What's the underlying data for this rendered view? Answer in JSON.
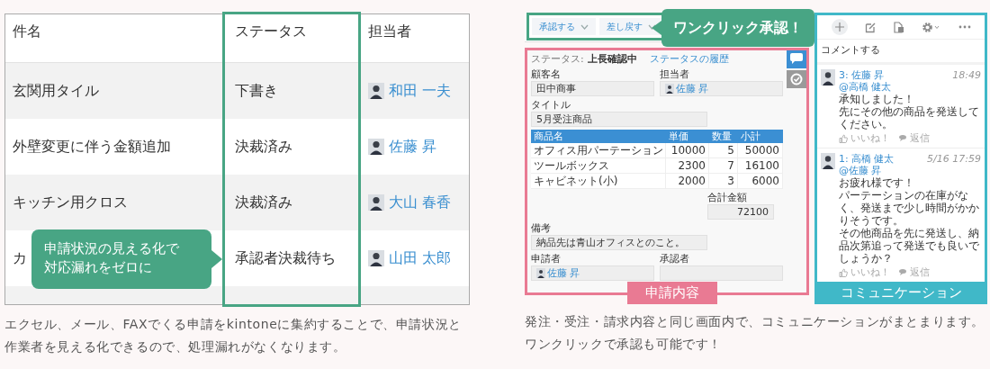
{
  "left": {
    "table": {
      "columns": [
        "件名",
        "ステータス",
        "担当者"
      ],
      "rows": [
        {
          "subject": "玄関用タイル",
          "status": "下書き",
          "assignee": "和田 一夫"
        },
        {
          "subject": "外壁変更に伴う金額追加",
          "status": "決裁済み",
          "assignee": "佐藤 昇"
        },
        {
          "subject": "キッチン用クロス",
          "status": "決裁済み",
          "assignee": "大山 春香"
        },
        {
          "subject": "カ",
          "status": "承認者決裁待ち",
          "assignee": "山田 太郎"
        }
      ]
    },
    "callout": [
      "申請状況の見える化で",
      "対応漏れをゼロに"
    ],
    "caption": "エクセル、メール、FAXでくる申請をkintoneに集約することで、申請状況と作業者を見える化できるので、処理漏れがなくなります。"
  },
  "right": {
    "actions": [
      "承認する",
      "差し戻す"
    ],
    "callout": "ワンクリック承認！",
    "record": {
      "status_label": "ステータス:",
      "status": "上長確認中",
      "history_link": "ステータスの履歴",
      "rows": [
        [
          {
            "kind": "text",
            "label": "顧客名",
            "value": "田中商事"
          },
          {
            "kind": "user",
            "label": "担当者",
            "value": "佐藤 昇"
          }
        ],
        [
          {
            "kind": "text",
            "label": "タイトル",
            "value": "5月受注商品"
          }
        ],
        [
          {
            "kind": "table",
            "columns": [
              "商品名",
              "単価",
              "数量",
              "小計"
            ],
            "rows": [
              [
                "オフィス用パーテーション",
                "10000",
                "5",
                "50000"
              ],
              [
                "ツールボックス",
                "2300",
                "7",
                "16100"
              ],
              [
                "キャビネット(小)",
                "2000",
                "3",
                "6000"
              ]
            ]
          }
        ],
        [
          {
            "kind": "number",
            "label": "合計金額",
            "value": "72100"
          }
        ],
        [
          {
            "kind": "text",
            "label": "備考",
            "value": "納品先は青山オフィスとのこと。"
          }
        ],
        [
          {
            "kind": "user",
            "label": "申請者",
            "value": "佐藤 昇"
          },
          {
            "kind": "text",
            "label": "承認者"
          }
        ]
      ],
      "side_tabs": [
        {
          "kind": "comments",
          "selected": true
        },
        {
          "kind": "history",
          "selected": false
        }
      ],
      "label": "申請内容"
    },
    "comments": {
      "prompt": "コメントする",
      "items": [
        {
          "number": "3:",
          "author": "佐藤 昇",
          "time": "18:49",
          "mention": "@高橋 健太",
          "body": [
            "承知しました！",
            "先にその他の商品を発送してください。"
          ],
          "like": "いいね！",
          "reply": "返信"
        },
        {
          "number": "1:",
          "author": "高橋 健太",
          "time": "5/16 17:59",
          "mention": "@佐藤 昇",
          "body": [
            "お疲れ様です！",
            "パーテーションの在庫がなく、発送まで少し時間がかかりそうです。",
            "その他商品を先に発送し、納品次第追って発送でも良いでしょうか？"
          ],
          "like": "いいね！",
          "reply": "返信"
        }
      ],
      "label": "コミュニケーション"
    },
    "caption": "発注・受注・請求内容と同じ画面内で、コミュニケーションがまとまります。ワンクリックで承認も可能です！"
  }
}
